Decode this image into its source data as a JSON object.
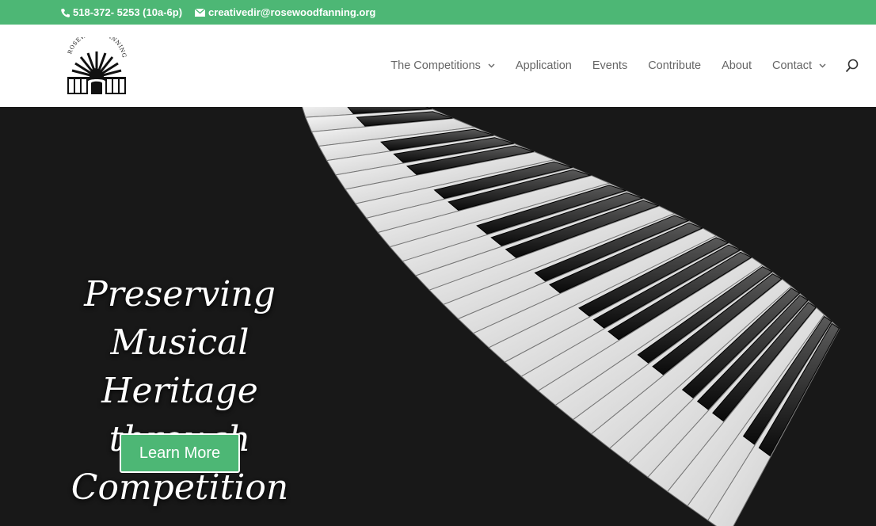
{
  "topbar": {
    "phone": "518-372- 5253 (10a-6p)",
    "email": "creativedir@rosewoodfanning.org",
    "phone_icon": "phone-icon",
    "email_icon": "envelope-icon",
    "background": "#4db775"
  },
  "logo": {
    "text": "ROSEWOOD FANNING"
  },
  "nav": {
    "items": [
      {
        "label": "The Competitions"
      },
      {
        "label": "Application"
      },
      {
        "label": "Events"
      },
      {
        "label": "Contribute"
      },
      {
        "label": "About"
      },
      {
        "label": "Contact"
      }
    ],
    "search_icon": "search-icon"
  },
  "hero": {
    "title_lines": [
      "Preserving Musical",
      "Heritage",
      "through Competition"
    ],
    "button_label": "Learn More",
    "button_color": "#4db775"
  }
}
